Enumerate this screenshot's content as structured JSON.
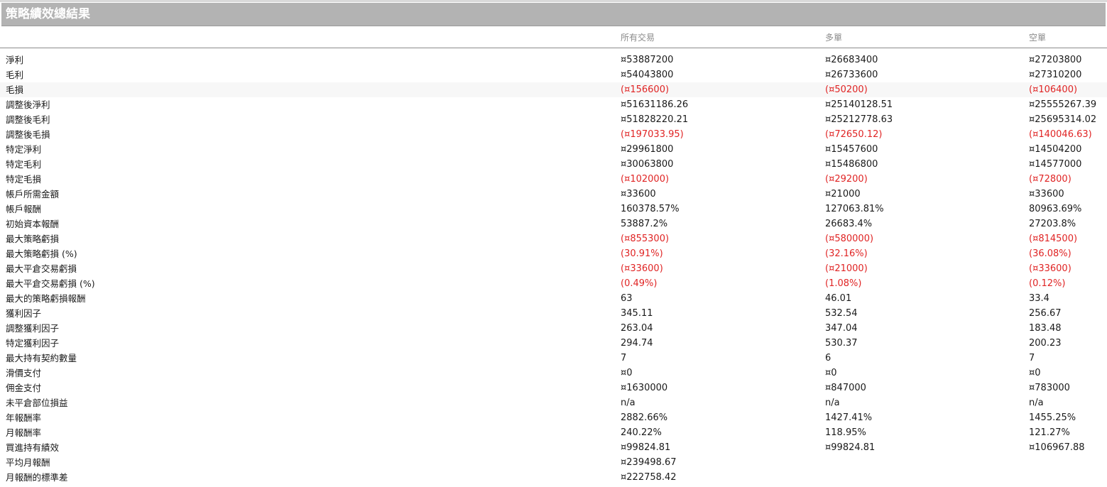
{
  "title": "策略績效總結果",
  "columns": [
    "所有交易",
    "多單",
    "空單"
  ],
  "rows": [
    {
      "label": "淨利",
      "values": [
        "¤53887200",
        "¤26683400",
        "¤27203800"
      ],
      "negative": false
    },
    {
      "label": "毛利",
      "values": [
        "¤54043800",
        "¤26733600",
        "¤27310200"
      ],
      "negative": false
    },
    {
      "label": "毛損",
      "values": [
        "(¤156600)",
        "(¤50200)",
        "(¤106400)"
      ],
      "negative": true
    },
    {
      "label": "調整後淨利",
      "values": [
        "¤51631186.26",
        "¤25140128.51",
        "¤25555267.39"
      ],
      "negative": false
    },
    {
      "label": "調整後毛利",
      "values": [
        "¤51828220.21",
        "¤25212778.63",
        "¤25695314.02"
      ],
      "negative": false
    },
    {
      "label": "調整後毛損",
      "values": [
        "(¤197033.95)",
        "(¤72650.12)",
        "(¤140046.63)"
      ],
      "negative": true
    },
    {
      "label": "特定淨利",
      "values": [
        "¤29961800",
        "¤15457600",
        "¤14504200"
      ],
      "negative": false
    },
    {
      "label": "特定毛利",
      "values": [
        "¤30063800",
        "¤15486800",
        "¤14577000"
      ],
      "negative": false
    },
    {
      "label": "特定毛損",
      "values": [
        "(¤102000)",
        "(¤29200)",
        "(¤72800)"
      ],
      "negative": true
    },
    {
      "label": "帳戶所需金額",
      "values": [
        "¤33600",
        "¤21000",
        "¤33600"
      ],
      "negative": false
    },
    {
      "label": "帳戶報酬",
      "values": [
        "160378.57%",
        "127063.81%",
        "80963.69%"
      ],
      "negative": false
    },
    {
      "label": "初始資本報酬",
      "values": [
        "53887.2%",
        "26683.4%",
        "27203.8%"
      ],
      "negative": false
    },
    {
      "label": "最大策略虧損",
      "values": [
        "(¤855300)",
        "(¤580000)",
        "(¤814500)"
      ],
      "negative": true
    },
    {
      "label": "最大策略虧損 (%)",
      "values": [
        "(30.91%)",
        "(32.16%)",
        "(36.08%)"
      ],
      "negative": true
    },
    {
      "label": "最大平倉交易虧損",
      "values": [
        "(¤33600)",
        "(¤21000)",
        "(¤33600)"
      ],
      "negative": true
    },
    {
      "label": "最大平倉交易虧損 (%)",
      "values": [
        "(0.49%)",
        "(1.08%)",
        "(0.12%)"
      ],
      "negative": true
    },
    {
      "label": "最大的策略虧損報酬",
      "values": [
        "63",
        "46.01",
        "33.4"
      ],
      "negative": false
    },
    {
      "label": "獲利因子",
      "values": [
        "345.11",
        "532.54",
        "256.67"
      ],
      "negative": false
    },
    {
      "label": "調整獲利因子",
      "values": [
        "263.04",
        "347.04",
        "183.48"
      ],
      "negative": false
    },
    {
      "label": "特定獲利因子",
      "values": [
        "294.74",
        "530.37",
        "200.23"
      ],
      "negative": false
    },
    {
      "label": "最大持有契約數量",
      "values": [
        "7",
        "6",
        "7"
      ],
      "negative": false
    },
    {
      "label": "滑價支付",
      "values": [
        "¤0",
        "¤0",
        "¤0"
      ],
      "negative": false
    },
    {
      "label": "佣金支付",
      "values": [
        "¤1630000",
        "¤847000",
        "¤783000"
      ],
      "negative": false
    },
    {
      "label": "未平倉部位損益",
      "values": [
        "n/a",
        "n/a",
        "n/a"
      ],
      "negative": false
    },
    {
      "label": "年報酬率",
      "values": [
        "2882.66%",
        "1427.41%",
        "1455.25%"
      ],
      "negative": false
    },
    {
      "label": "月報酬率",
      "values": [
        "240.22%",
        "118.95%",
        "121.27%"
      ],
      "negative": false
    },
    {
      "label": "買進持有績效",
      "values": [
        "¤99824.81",
        "¤99824.81",
        "¤106967.88"
      ],
      "negative": false
    },
    {
      "label": "平均月報酬",
      "values": [
        "¤239498.67",
        "",
        ""
      ],
      "negative": false
    },
    {
      "label": "月報酬的標準差",
      "values": [
        "¤222758.42",
        "",
        ""
      ],
      "negative": false
    }
  ],
  "colors": {
    "title_bar": "#b3b3b3",
    "negative_text": "#e02424",
    "header_text": "#8a8a8a"
  }
}
